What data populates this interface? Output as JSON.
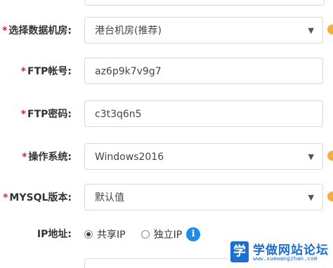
{
  "form": {
    "datacenter": {
      "required_mark": "*",
      "label": "选择数据机房:",
      "value": "港台机房(推荐)",
      "arrow": "▼"
    },
    "ftp_account": {
      "required_mark": "*",
      "label": "FTP帐号:",
      "value": "az6p9k7v9g7"
    },
    "ftp_password": {
      "required_mark": "*",
      "label": "FTP密码:",
      "value": "c3t3q6n5"
    },
    "os": {
      "required_mark": "*",
      "label": "操作系统:",
      "value": "Windows2016",
      "arrow": "▼"
    },
    "mysql": {
      "required_mark": "*",
      "label": "MYSQL版本:",
      "value": "默认值",
      "arrow": "▼"
    },
    "ip": {
      "label": "IP地址:",
      "options": [
        {
          "label": "共享IP",
          "checked": true
        },
        {
          "label": "独立IP",
          "checked": false
        }
      ],
      "info_glyph": "i"
    }
  },
  "watermark": {
    "logo_char": "学",
    "title": "学做网站论坛",
    "url": "www.xuewangzhan.com"
  },
  "colors": {
    "required": "#e0242b",
    "info": "#1a8ee8",
    "watermark": "#1a6fd1"
  }
}
